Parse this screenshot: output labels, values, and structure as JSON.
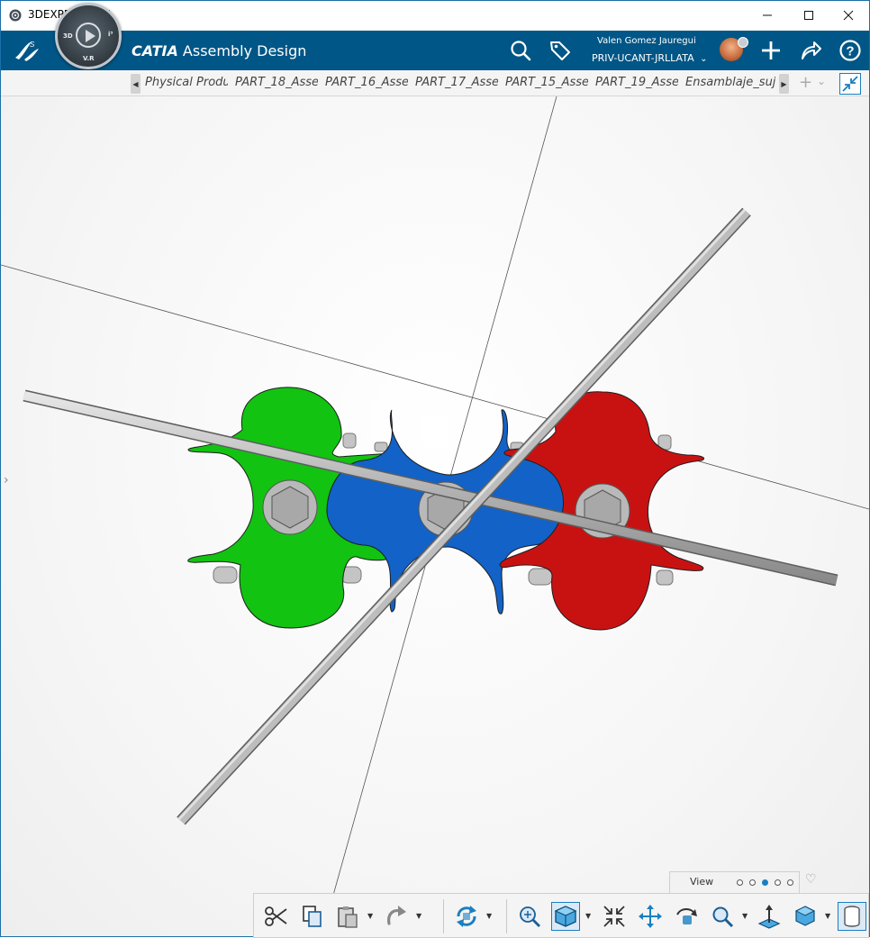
{
  "window": {
    "title": "3DEXPERIENCE",
    "minimize_icon": "minimize-icon",
    "maximize_icon": "maximize-icon",
    "close_icon": "close-icon"
  },
  "header": {
    "brand_bold": "CATIA",
    "app_title": " Assembly Design",
    "compass_labels": {
      "left": "3D",
      "right": "i³",
      "bottom": "V.R"
    },
    "user_name": "Valen Gomez Jauregui",
    "tenant": "PRIV-UCANT-JRLLATA",
    "colors": {
      "header_bg": "#005686"
    }
  },
  "tabs": [
    {
      "label": "Physical Produ"
    },
    {
      "label": "PART_18_Asse"
    },
    {
      "label": "PART_16_Asse"
    },
    {
      "label": "PART_17_Asse"
    },
    {
      "label": "PART_15_Asse"
    },
    {
      "label": "PART_19_Asse"
    },
    {
      "label": "Ensamblaje_suj"
    }
  ],
  "tab_controls": {
    "add": "+",
    "more": "⌄"
  },
  "model": {
    "part_colors": {
      "green": "#12c312",
      "blue": "#1262c8",
      "red": "#c81212",
      "rod": "#b8b8b8",
      "bolt": "#a8a8a8"
    }
  },
  "view_panel": {
    "label": "View",
    "dots": 5,
    "active_dot": 3
  },
  "toolbar": {
    "cut": "scissors-icon",
    "copy": "copy-icon",
    "paste": "paste-icon",
    "redo": "redo-icon",
    "update": "update-icon",
    "fit_all": "fit-all-icon",
    "view_mode": "cube-icon",
    "compass_snap": "snap-icon",
    "pan": "pan-icon",
    "rotate": "rotate-icon",
    "zoom": "zoom-icon",
    "normal_view": "normal-view-icon",
    "view_selector": "iso-view-icon",
    "cylinder": "cylinder-icon"
  }
}
